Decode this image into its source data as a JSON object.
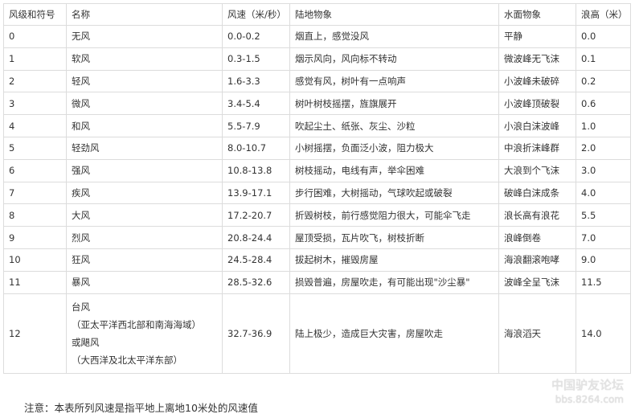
{
  "table": {
    "headers": [
      "风级和符号",
      "名称",
      "风速（米/秒）",
      "陆地物象",
      "水面物象",
      "浪高（米）"
    ],
    "rows": [
      {
        "level": "0",
        "name": "无风",
        "speed": "0.0-0.2",
        "land": "烟直上，感觉没风",
        "water": "平静",
        "wave": "0.0"
      },
      {
        "level": "1",
        "name": "软风",
        "speed": "0.3-1.5",
        "land": "烟示风向，风向标不转动",
        "water": "微波峰无飞沫",
        "wave": "0.1"
      },
      {
        "level": "2",
        "name": "轻风",
        "speed": "1.6-3.3",
        "land": "感觉有风，树叶有一点响声",
        "water": "小波峰未破碎",
        "wave": "0.2"
      },
      {
        "level": "3",
        "name": "微风",
        "speed": "3.4-5.4",
        "land": "树叶树枝摇摆，旌旗展开",
        "water": "小波峰顶破裂",
        "wave": "0.6"
      },
      {
        "level": "4",
        "name": "和风",
        "speed": "5.5-7.9",
        "land": "吹起尘土、纸张、灰尘、沙粒",
        "water": "小浪白沫波峰",
        "wave": "1.0"
      },
      {
        "level": "5",
        "name": "轻劲风",
        "speed": "8.0-10.7",
        "land": "小树摇摆，负面泛小波，阻力极大",
        "water": "中浪折沫峰群",
        "wave": "2.0"
      },
      {
        "level": "6",
        "name": "强风",
        "speed": "10.8-13.8",
        "land": "树枝摇动，电线有声，举伞困难",
        "water": "大浪到个飞沫",
        "wave": "3.0"
      },
      {
        "level": "7",
        "name": "疾风",
        "speed": "13.9-17.1",
        "land": "步行困难，大树摇动，气球吹起或破裂",
        "water": "破峰白沫成条",
        "wave": "4.0"
      },
      {
        "level": "8",
        "name": "大风",
        "speed": "17.2-20.7",
        "land": "折毁树枝，前行感觉阻力很大，可能伞飞走",
        "water": "浪长高有浪花",
        "wave": "5.5"
      },
      {
        "level": "9",
        "name": "烈风",
        "speed": "20.8-24.4",
        "land": "屋顶受损，瓦片吹飞，树枝折断",
        "water": "浪峰倒卷",
        "wave": "7.0"
      },
      {
        "level": "10",
        "name": "狂风",
        "speed": "24.5-28.4",
        "land": "拔起树木，摧毁房屋",
        "water": "海浪翻滚咆哮",
        "wave": "9.0"
      },
      {
        "level": "11",
        "name": "暴风",
        "speed": "28.5-32.6",
        "land": "损毁普遍，房屋吹走，有可能出现\"沙尘暴\"",
        "water": "波峰全呈飞沫",
        "wave": "11.5"
      }
    ],
    "last_row": {
      "level": "12",
      "name_lines": [
        "台风",
        "（亚太平洋西北部和南海海域）",
        "或飓风",
        "（大西洋及北太平洋东部）"
      ],
      "speed": "32.7-36.9",
      "land": "陆上极少，造成巨大灾害，房屋吹走",
      "water": "海浪滔天",
      "wave": "14.0"
    }
  },
  "note": "注意：本表所列风速是指平地上离地10米处的风速值",
  "watermark": {
    "title": "中国驴友论坛",
    "url": "bbs.8264.com"
  }
}
